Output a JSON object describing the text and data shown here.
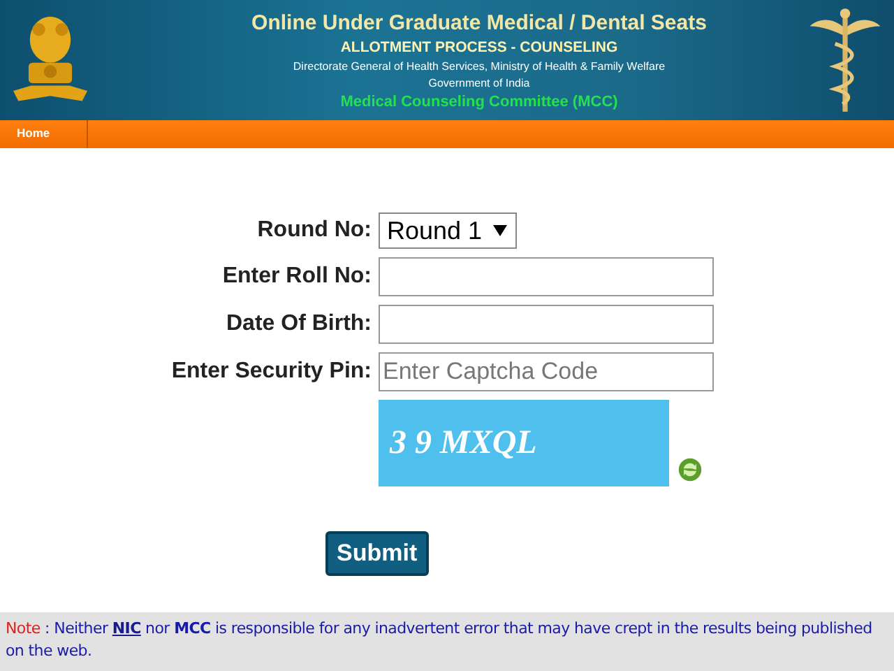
{
  "header": {
    "title": "Online Under Graduate Medical / Dental Seats",
    "subtitle": "ALLOTMENT PROCESS - COUNSELING",
    "department": "Directorate General of Health Services, Ministry of Health & Family Welfare",
    "government": "Government of India",
    "committee": "Medical Counseling Committee (MCC)"
  },
  "nav": [
    {
      "label": "Home"
    }
  ],
  "form": {
    "fields": [
      {
        "kind": "select",
        "label": "Round No:",
        "value": "Round 1"
      },
      {
        "kind": "text",
        "label": "Enter Roll No:"
      },
      {
        "kind": "text",
        "label": "Date Of Birth:"
      },
      {
        "kind": "text",
        "label": "Enter Security Pin:",
        "placeholder": "Enter Captcha Code"
      }
    ],
    "captcha": "3 9 MXQL",
    "submit": "Submit"
  },
  "note": {
    "label": "Note",
    "before": " : Neither ",
    "link": "NIC",
    "after": " nor **MCC**  is responsible for any inadvertent error that may have crept in the results being published on the web."
  }
}
